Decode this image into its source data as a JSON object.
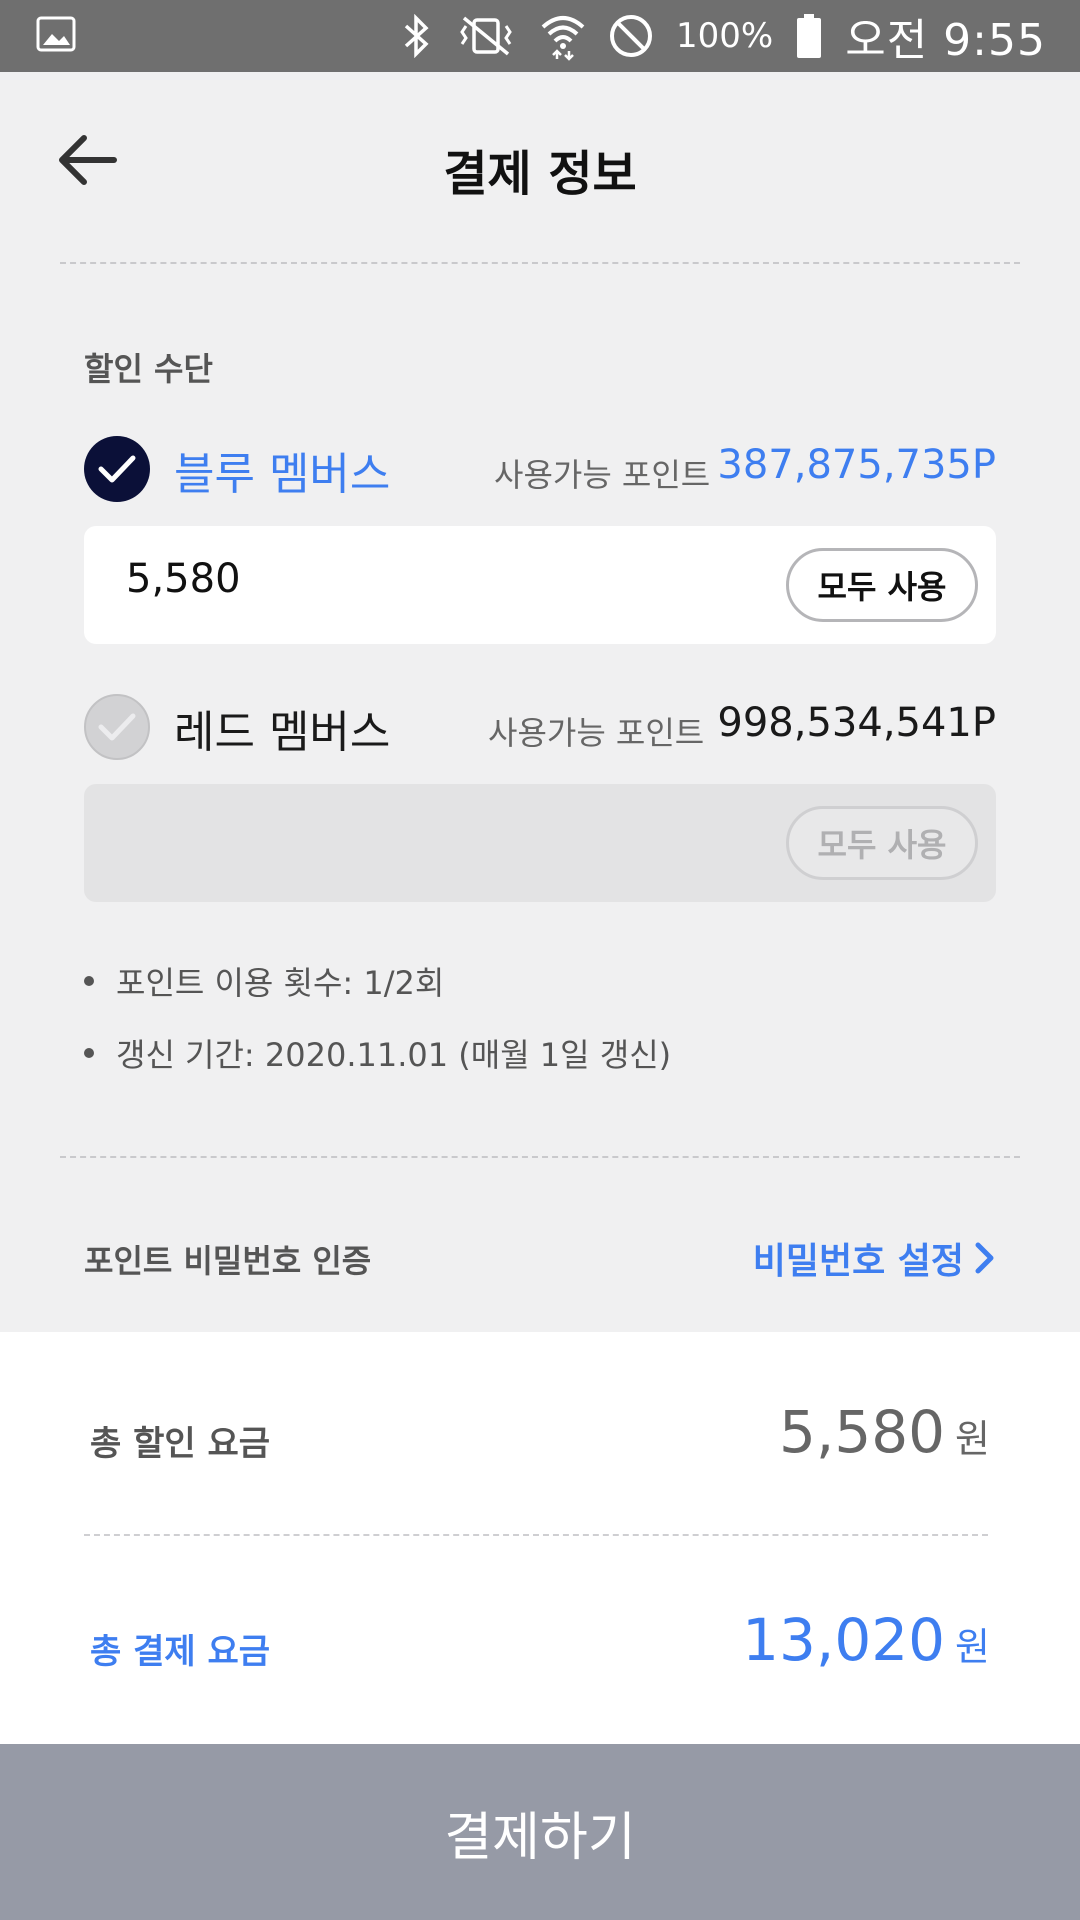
{
  "status_bar": {
    "battery": "100%",
    "time": "오전 9:55",
    "icons": [
      "gallery-icon",
      "bluetooth-icon",
      "vibrate-icon",
      "wifi-icon",
      "do-not-disturb-icon",
      "battery-icon"
    ]
  },
  "header": {
    "title": "결제 정보",
    "back_icon": "arrow-left-icon"
  },
  "discount": {
    "section_label": "할인 수단",
    "members": [
      {
        "name": "블루 멤버스",
        "checked": true,
        "available_label": "사용가능 포인트",
        "available_points": "387,875,735P",
        "input_value": "5,580",
        "use_all_label": "모두 사용"
      },
      {
        "name": "레드 멤버스",
        "checked": false,
        "available_label": "사용가능 포인트",
        "available_points": "998,534,541P",
        "input_value": "",
        "use_all_label": "모두 사용"
      }
    ],
    "notes": [
      "포인트 이용 횟수: 1/2회",
      "갱신 기간: 2020.11.01 (매월 1일 갱신)"
    ]
  },
  "password": {
    "label": "포인트 비밀번호 인증",
    "link": "비밀번호 설정"
  },
  "summary": {
    "discount_label": "총 할인 요금",
    "discount_value": "5,580",
    "payment_label": "총 결제 요금",
    "payment_value": "13,020",
    "unit": "원"
  },
  "pay_button": "결제하기",
  "colors": {
    "accent": "#3e7ef0",
    "check_on": "#0b1038",
    "pay_button_bg": "#969aa6"
  }
}
